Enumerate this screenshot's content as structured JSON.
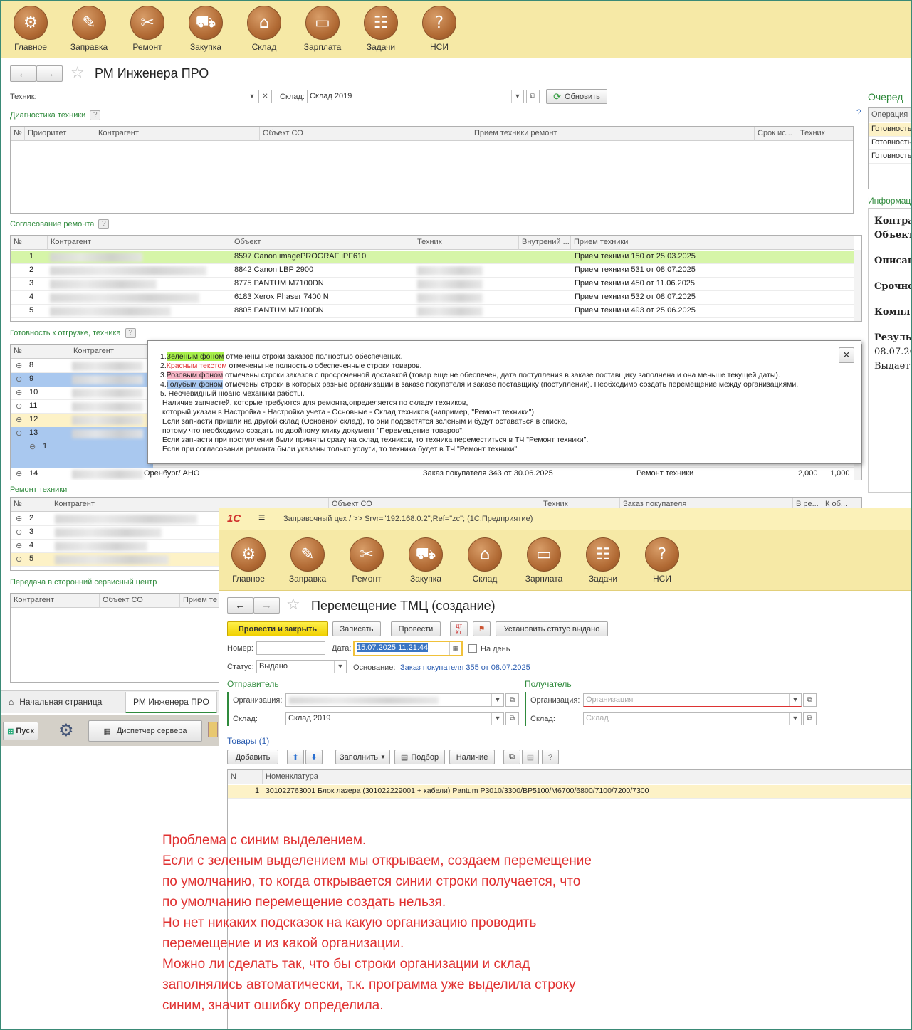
{
  "app_sections": [
    "Главное",
    "Заправка",
    "Ремонт",
    "Закупка",
    "Склад",
    "Зарплата",
    "Задачи",
    "НСИ"
  ],
  "section_icons": [
    "gears-icon",
    "fuel-icon",
    "tools-icon",
    "cart-icon",
    "warehouse-icon",
    "wallet-icon",
    "tasks-icon",
    "book-icon"
  ],
  "main": {
    "title": "РМ Инженера ПРО",
    "technician_label": "Техник:",
    "technician_value": "",
    "warehouse_label": "Склад:",
    "warehouse_value": "Склад 2019",
    "refresh_label": "Обновить",
    "queue_title": "Очеред",
    "queue_header": "Операция",
    "queue_rows": [
      "Готовность",
      "Готовность",
      "Готовность"
    ],
    "info_title": "Информац",
    "info_lines": [
      "Контра",
      "Объект",
      "Описан",
      "Срочно",
      "Компле",
      "Резуль",
      "08.07.20",
      "Выдает"
    ]
  },
  "diagnostics": {
    "title": "Диагностика техники",
    "columns": [
      "№",
      "Приоритет",
      "Контрагент",
      "Объект СО",
      "Прием техники ремонт",
      "Срок ис...",
      "Техник"
    ]
  },
  "approval": {
    "title": "Согласование ремонта",
    "columns": [
      "№",
      "Контрагент",
      "Объект",
      "Техник",
      "Внутрений ...",
      "Прием техники"
    ],
    "rows": [
      {
        "n": "1",
        "object": "8597 Canon  imagePROGRAF iPF610",
        "reception": "Прием техники 150 от 25.03.2025"
      },
      {
        "n": "2",
        "object": "8842 Canon LBP 2900",
        "reception": "Прием техники 531 от 08.07.2025"
      },
      {
        "n": "3",
        "object": "8775 PANTUM M7100DN",
        "reception": "Прием техники 450 от 11.06.2025"
      },
      {
        "n": "4",
        "object": "6183 Xerox Phaser 7400 N",
        "reception": "Прием техники 532 от 08.07.2025"
      },
      {
        "n": "5",
        "object": "8805 PANTUM M7100DN",
        "reception": "Прием техники 493 от 25.06.2025"
      }
    ]
  },
  "ready": {
    "title": "Готовность к отгрузке, техника",
    "columns": [
      "№",
      "Контрагент"
    ],
    "rows": [
      "8",
      "9",
      "10",
      "11",
      "12",
      "13",
      "1",
      "",
      "14"
    ],
    "row14": {
      "counterparty": "Оренбург/ АНО",
      "order": "Заказ покупателя 343 от 30.06.2025",
      "kind": "Ремонт техники",
      "qty1": "2,000",
      "qty2": "1,000"
    }
  },
  "tooltip": {
    "lines": [
      [
        "1.",
        "Зеленым фоном",
        " отмечены строки заказов полностью обеспеченых."
      ],
      [
        "2.",
        "Красным текстом",
        " отмечены не полностью обеспеченные строки товаров."
      ],
      [
        "3.",
        "Розовым фоном",
        " отмечены строки заказов с просроченной доставкой (товар еще не обеспечен, дата поступления в заказе поставщику заполнена и она меньше текущей даты)."
      ],
      [
        "4.",
        "Голубым фоном",
        " отмечены строки в которых разные организации в заказе покупателя и заказе поставщику (поступлении). Необходимо создать перемещение между организациями."
      ]
    ],
    "extra": [
      "5.  Неочевидный нюанс механики работы.",
      "Наличие запчастей, которые требуются для ремонта,определяется по складу техников,",
      "который указан в Настройка - Настройка учета - Основные - Склад техников (например, \"Ремонт техники\").",
      "Если запчасти пришли на другой склад (Основной склад), то они подсветятся зелёным и будут оставаться в списке,",
      "потому что необходимо создать по двойному клику документ \"Перемещение товаров\".",
      "Если запчасти при поступлении были приняты сразу на склад техников, то техника переместиться в ТЧ \"Ремонт техники\".",
      "Если при согласовании ремонта были указаны только услуги, то техника будет в ТЧ \"Ремонт техники\"."
    ]
  },
  "repair": {
    "title": "Ремонт техники",
    "columns": [
      "№",
      "Контрагент",
      "Объект СО",
      "Техник",
      "Заказ покупателя",
      "В ре...",
      "К об..."
    ],
    "rows": [
      "2",
      "3",
      "4",
      "5"
    ]
  },
  "transfer_sc": {
    "title": "Передача в сторонний сервисный центр",
    "columns": [
      "Контрагент",
      "Объект СО",
      "Прием те"
    ]
  },
  "bottom_tabs": [
    "Начальная страница",
    "РМ Инженера ПРО"
  ],
  "taskbar": {
    "start": "Пуск",
    "server": "Диспетчер сервера"
  },
  "doc": {
    "logo": "1С",
    "caption": "Заправочный цех / >> Srvr=\"192.168.0.2\";Ref=\"zc\";  (1С:Предприятие)",
    "title": "Перемещение ТМЦ (создание)",
    "btn_post_close": "Провести и закрыть",
    "btn_save": "Записать",
    "btn_post": "Провести",
    "btn_status": "Установить статус выдано",
    "number_label": "Номер:",
    "number_value": "",
    "date_label": "Дата:",
    "date_value": "15.07.2025 11:21:44",
    "per_day_label": "На день",
    "status_label": "Статус:",
    "status_value": "Выдано",
    "basis_label": "Основание:",
    "basis_link": "Заказ покупателя 355 от 08.07.2025",
    "sender_title": "Отправитель",
    "receiver_title": "Получатель",
    "org_label": "Организация:",
    "wh_label": "Склад:",
    "sender_wh": "Склад 2019",
    "receiver_org_placeholder": "Организация",
    "receiver_wh_placeholder": "Склад",
    "goods_title": "Товары (1)",
    "btn_add": "Добавить",
    "btn_fill": "Заполнить",
    "btn_pick": "Подбор",
    "btn_stock": "Наличие",
    "goods_columns": [
      "N",
      "Номенклатура"
    ],
    "goods_rows": [
      {
        "n": "1",
        "name": "301022763001 Блок лазера (301022229001 + кабели) Pantum P3010/3300/BP5100/M6700/6800/7100/7200/7300"
      }
    ]
  },
  "annotation": [
    "Проблема с синим выделением.",
    "Если с зеленым выделением мы открываем, создаем перемещение",
    "по умолчанию, то когда открывается синии строки получается, что",
    "по умолчанию перемещение создать нельзя.",
    "Но нет никаких подсказок на какую организацию проводить",
    "перемещение и из какой организации.",
    "Можно ли сделать так, что бы строки организации и склад",
    "заполнялись автоматически, т.к. программа уже выделила строку",
    "синим, значит ошибку определила."
  ],
  "colors": {
    "accent_green": "#2f8a3c",
    "highlight_green": "#d6f5a8",
    "highlight_blue": "#a9c8ef",
    "highlight_yellow": "#fdf2c7",
    "annotation_red": "#e03131"
  }
}
